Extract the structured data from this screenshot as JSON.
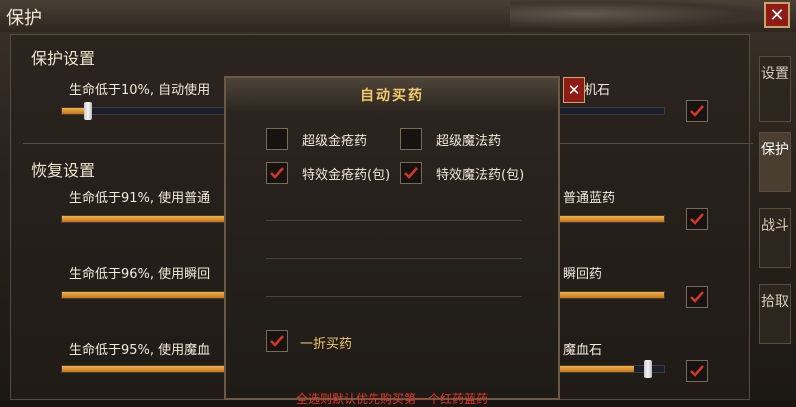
{
  "window": {
    "title": "保护",
    "close_glyph": "✕"
  },
  "tabs": [
    {
      "label": "设置",
      "active": false
    },
    {
      "label": "保护",
      "active": true
    },
    {
      "label": "战斗",
      "active": false
    },
    {
      "label": "拾取",
      "active": false
    }
  ],
  "protect": {
    "heading": "保护设置",
    "rows": [
      {
        "label": "生命低于10%, 自动使用",
        "right_label": "随机石",
        "level": 0.1,
        "checked": true
      }
    ]
  },
  "recover": {
    "heading": "恢复设置",
    "rows": [
      {
        "label": "生命低于91%, 使用普通",
        "right_label": "普通蓝药",
        "level": 1.0,
        "checked": true
      },
      {
        "label": "生命低于96%, 使用瞬回",
        "right_label": "瞬回药",
        "level": 1.0,
        "checked": true
      },
      {
        "label": "生命低于95%, 使用魔血",
        "right_label": "魔血石",
        "level": 0.95,
        "checked": true
      }
    ]
  },
  "modal": {
    "title": "自动买药",
    "close_glyph": "✕",
    "options": [
      {
        "label": "超级金疮药",
        "checked": false
      },
      {
        "label": "超级魔法药",
        "checked": false
      },
      {
        "label": "特效金疮药(包)",
        "checked": true
      },
      {
        "label": "特效魔法药(包)",
        "checked": true
      }
    ],
    "discount_label": "一折买药",
    "discount_checked": true,
    "hint": "全选则默认优先购买第一个红药蓝药"
  },
  "colors": {
    "accent_gold": "#f3c96b",
    "check_red": "#d2372a",
    "hint_red": "#e0392b"
  }
}
